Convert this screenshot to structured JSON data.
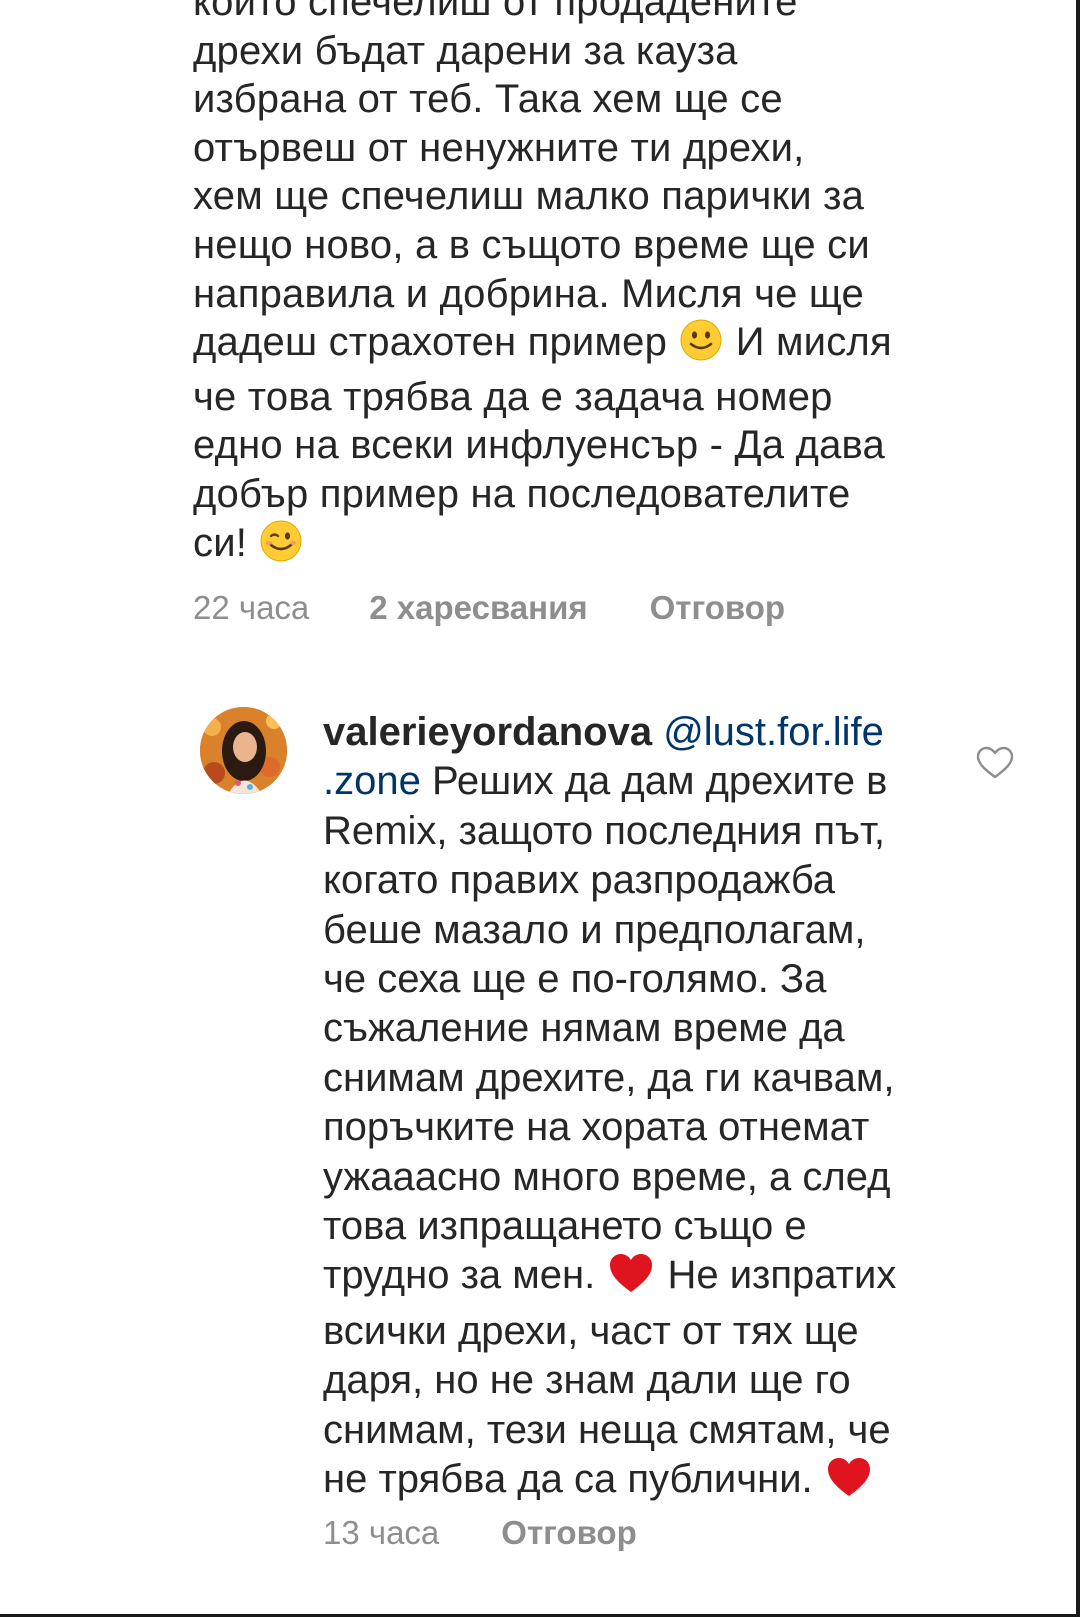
{
  "parent_comment": {
    "text_lines": [
      "които спечелиш от продадените",
      "дрехи бъдат дарени за кауза",
      "избрана от теб. Така хем ще се",
      "отървеш от ненужните ти дрехи,",
      "хем ще спечелиш малко парички за",
      "нещо ново, а в същото време ще си",
      "направила и добрина. Мисля че ще"
    ],
    "line8_before": "дадеш страхотен пример ",
    "line8_after": " И мисля",
    "text_lines_2": [
      "че това трябва да е задача номер",
      "едно на всеки инфлуенсър - Да дава",
      "добър пример на последователите"
    ],
    "line12_before": "си! ",
    "time": "22 часа",
    "likes": "2 харесвания",
    "reply_label": "Отговор"
  },
  "reply_comment": {
    "username": "valerieyordanova",
    "mention": "@lust.for.life.zone",
    "mention_part1": "@lust.for.life",
    "mention_part2": ".zone",
    "lines": {
      "l1_rest": " Реших да дам дрехите в",
      "l2": "Remix, защото последния път,",
      "l3": "когато правих разпродажба",
      "l4": "беше мазало и предполагам,",
      "l5": "че сеха ще е по-голямо. За",
      "l6": "съжаление нямам време да",
      "l7": "снимам дрехите, да ги качвам,",
      "l8": "поръчките на хората отнемат",
      "l9": "ужааасно много време, а след",
      "l10": "това изпращането също е",
      "l11_before": "трудно за мен. ",
      "l11_after": " Не изпратих",
      "l12": "всички дрехи, част от тях ще",
      "l13": "даря, но не знам дали ще го",
      "l14": "снимам, тези неща смятам, че",
      "l15_before": "не трябва да са публични. "
    },
    "time": "13 часа",
    "reply_label": "Отговор"
  },
  "icons": {
    "smile": "slightly-smiling-face-emoji",
    "wink": "winking-face-emoji",
    "heart_emoji": "red-heart-emoji",
    "like": "heart-outline-icon"
  },
  "colors": {
    "text": "#262626",
    "meta": "#8e8e8e",
    "mention": "#003569",
    "heart": "#e0141e",
    "emoji_yellow": "#ffcc33"
  }
}
